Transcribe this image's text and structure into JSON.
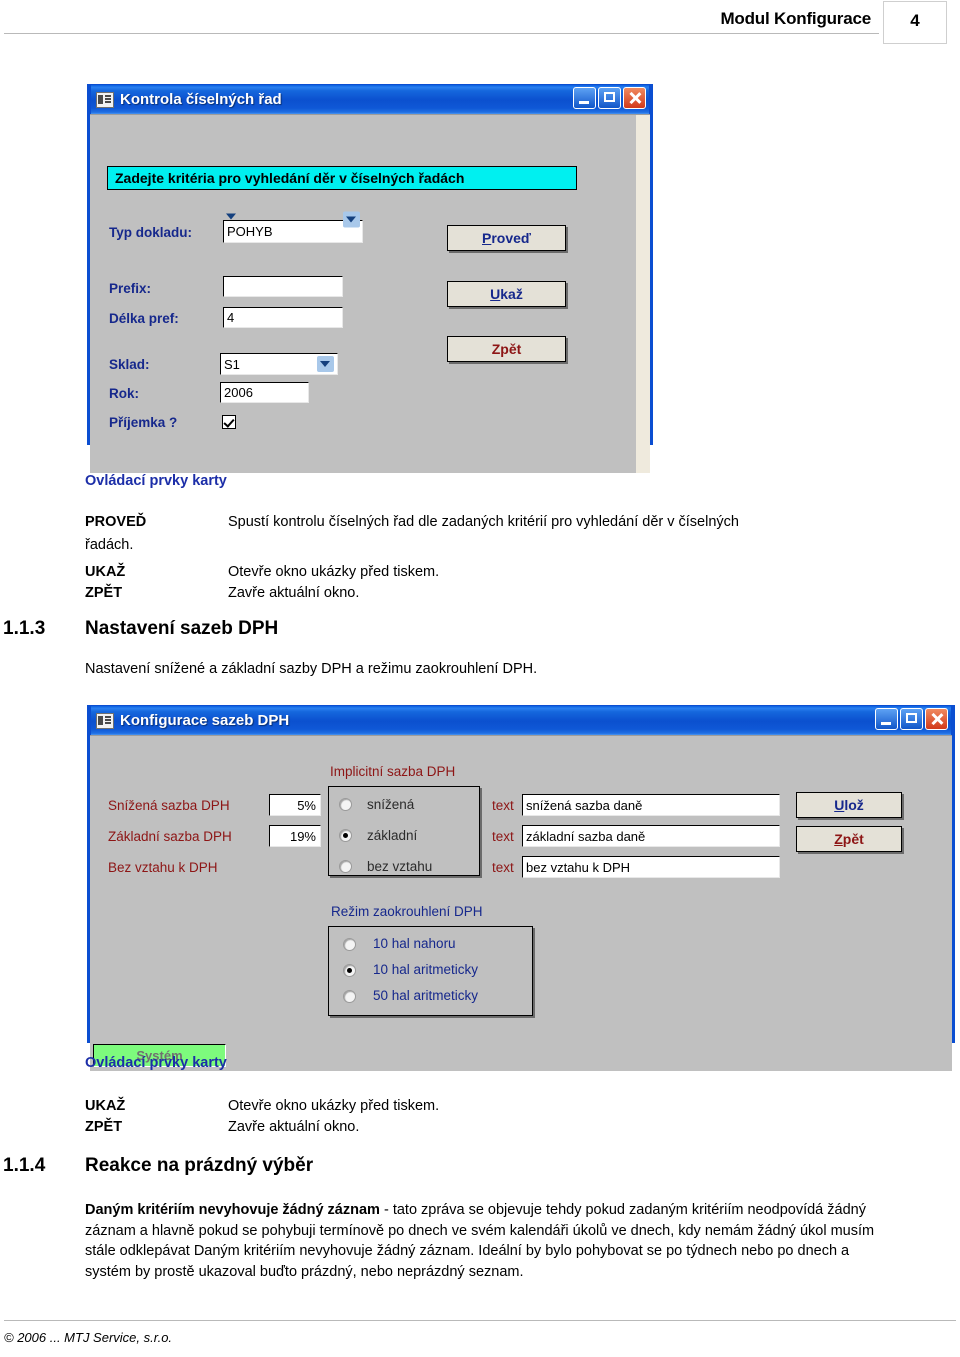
{
  "header": {
    "title": "Modul Konfigurace",
    "page_number": "4"
  },
  "dialog1": {
    "title": "Kontrola číselných řad",
    "banner": "Zadejte kritéria pro vyhledání děr v číselných řadách",
    "fields": [
      {
        "label": "Typ dokladu:",
        "value": "POHYB",
        "type": "combobox"
      },
      {
        "label": "Prefix:",
        "value": "",
        "type": "text"
      },
      {
        "label": "Délka pref:",
        "value": "4",
        "type": "text"
      },
      {
        "label": "Sklad:",
        "value": "S1",
        "type": "combobox"
      },
      {
        "label": "Rok:",
        "value": "2006",
        "type": "text"
      },
      {
        "label": "Příjemka ?",
        "value": "checked",
        "type": "checkbox"
      }
    ],
    "buttons": [
      {
        "accel": "P",
        "rest": "roveď",
        "color": "#16288c"
      },
      {
        "accel": "U",
        "rest": "kaž",
        "color": "#16288c"
      },
      {
        "accel": "",
        "rest": "Zpět",
        "color": "#8d1515"
      }
    ]
  },
  "section1": {
    "heading": "Ovládací prvky karty",
    "terms": [
      {
        "term": "PROVEĎ",
        "def": "Spustí kontrolu číselných řad dle zadaných kritérií pro vyhledání děr v číselných"
      },
      {
        "term": "",
        "def": ""
      },
      {
        "term": "UKAŽ",
        "def": "Otevře okno ukázky před tiskem."
      },
      {
        "term": "ZPĚT",
        "def": "Zavře aktuální okno."
      }
    ],
    "wrap_line": "řadách."
  },
  "heading113": {
    "number": "1.1.3",
    "text": "Nastavení sazeb DPH"
  },
  "intro113": "Nastavení snížené a základní sazby DPH a režimu zaokrouhlení DPH.",
  "dialog2": {
    "title": "Konfigurace sazeb DPH",
    "group_implicit_label": "Implicitní sazba DPH",
    "group_rounding_label": "Režim zaokrouhlení DPH",
    "text_label": "text",
    "rows": [
      {
        "label": "Snížená sazba DPH",
        "rate": "5%",
        "radio": "snížená",
        "selected": false,
        "text": "snížená sazba daně"
      },
      {
        "label": "Základní sazba DPH",
        "rate": "19%",
        "radio": "základní",
        "selected": true,
        "text": "základní sazba daně"
      },
      {
        "label": "Bez vztahu k DPH",
        "rate": "",
        "radio": "bez vztahu",
        "selected": false,
        "text": "bez vztahu k DPH"
      }
    ],
    "rounding_options": [
      {
        "label": "10 hal nahoru",
        "selected": false
      },
      {
        "label": "10 hal aritmeticky",
        "selected": true
      },
      {
        "label": "50 hal aritmeticky",
        "selected": false
      }
    ],
    "buttons": [
      {
        "accel": "U",
        "rest": "lož",
        "color": "#16288c"
      },
      {
        "accel": "Z",
        "rest": "pět",
        "color": "#8d1515"
      }
    ],
    "statusbar": "Systém"
  },
  "section2": {
    "heading": "Ovládací prvky karty",
    "terms": [
      {
        "term": "UKAŽ",
        "def": "Otevře okno ukázky před tiskem."
      },
      {
        "term": "ZPĚT",
        "def": "Zavře aktuální okno."
      }
    ]
  },
  "heading114": {
    "number": "1.1.4",
    "text": "Reakce na prázdný výběr"
  },
  "para114": {
    "bold_lead": "Daným kritériím nevyhovuje žádný záznam",
    "rest": " - tato zpráva se objevuje tehdy pokud zadaným kritériím neodpovídá žádný záznam a hlavně pokud se pohybuji termínově po dnech ve svém kalendáři úkolů ve dnech, kdy nemám žádný úkol musím stále odklepávat Daným kritériím nevyhovuje žádný záznam. Ideální by bylo pohybovat se po týdnech nebo po dnech a systém by prostě ukazoval buďto prázdný, nebo neprázdný seznam."
  },
  "footer": {
    "text": "© 2006 ... MTJ Service, s.r.o."
  }
}
